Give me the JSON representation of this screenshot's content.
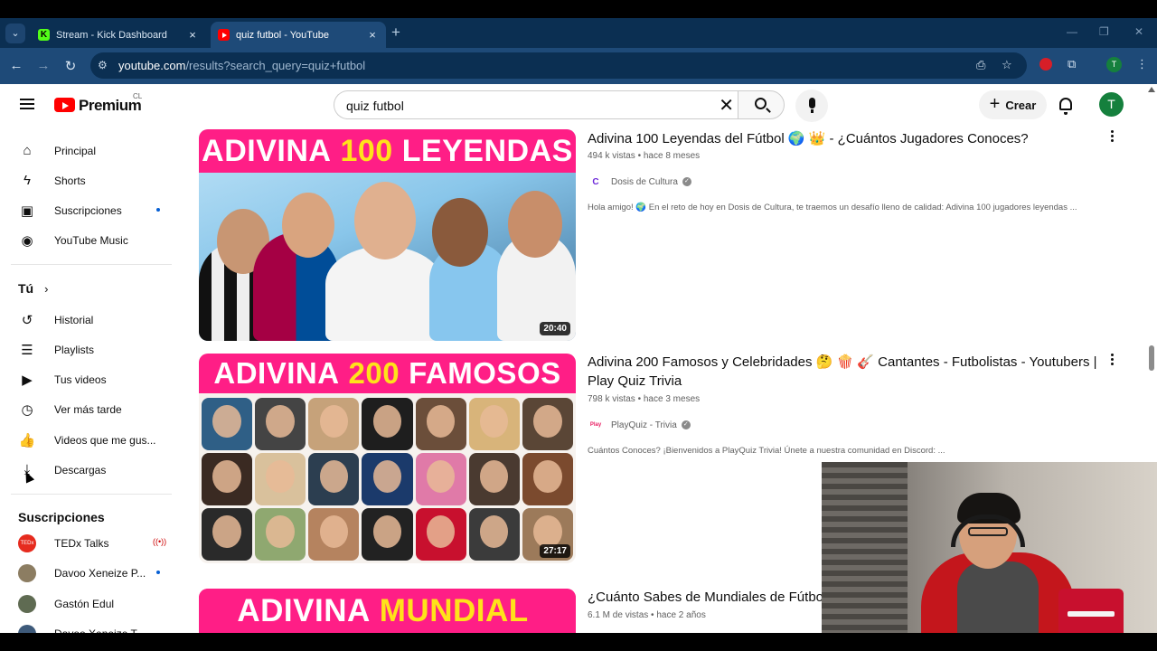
{
  "browser": {
    "tabs": [
      {
        "label": "Stream - Kick Dashboard",
        "active": false
      },
      {
        "label": "quiz futbol - YouTube",
        "active": true
      }
    ],
    "url_host": "youtube.com",
    "url_path": "/results?search_query=quiz+futbol",
    "profile_initial": "T"
  },
  "masthead": {
    "brand": "Premium",
    "country": "CL",
    "search_value": "quiz futbol",
    "create_label": "Crear",
    "avatar_initial": "T"
  },
  "sidebar": {
    "main": [
      {
        "label": "Principal",
        "icon": "home-icon"
      },
      {
        "label": "Shorts",
        "icon": "shorts-icon"
      },
      {
        "label": "Suscripciones",
        "icon": "subscriptions-icon"
      },
      {
        "label": "YouTube Music",
        "icon": "youtube-music-icon"
      }
    ],
    "you_heading": "Tú",
    "you": [
      {
        "label": "Historial",
        "icon": "history-icon"
      },
      {
        "label": "Playlists",
        "icon": "playlists-icon"
      },
      {
        "label": "Tus videos",
        "icon": "your-videos-icon"
      },
      {
        "label": "Ver más tarde",
        "icon": "watch-later-icon"
      },
      {
        "label": "Videos que me gus...",
        "icon": "liked-videos-icon"
      },
      {
        "label": "Descargas",
        "icon": "downloads-icon"
      }
    ],
    "subs_heading": "Suscripciones",
    "subs": [
      {
        "label": "TEDx Talks",
        "avatar": "TEDx"
      },
      {
        "label": "Davoo Xeneize P...",
        "avatar": ""
      },
      {
        "label": "Gastón Edul",
        "avatar": ""
      },
      {
        "label": "Davoo Xeneize T...",
        "avatar": ""
      }
    ]
  },
  "results": [
    {
      "thumb_word": "ADIVINA",
      "thumb_num": "100",
      "thumb_tail": "LEYENDAS",
      "duration": "20:40",
      "title": "Adivina 100 Leyendas del Fútbol 🌍 👑 - ¿Cuántos Jugadores Conoces?",
      "meta_views": "494 k vistas",
      "meta_age": "hace 8 meses",
      "channel": "Dosis de Cultura",
      "channel_initial": "C",
      "description": "Hola amigo! 🌍 En el reto de hoy en Dosis de Cultura, te traemos un desafío lleno de calidad: Adivina 100 jugadores leyendas ..."
    },
    {
      "thumb_word": "ADIVINA",
      "thumb_num": "200",
      "thumb_tail": "FAMOSOS",
      "duration": "27:17",
      "title": "Adivina 200 Famosos y Celebridades 🤔 🍿 🎸 Cantantes - Futbolistas - Youtubers | Play Quiz Trivia",
      "meta_views": "798 k vistas",
      "meta_age": "hace 3 meses",
      "channel": "PlayQuiz - Trivia",
      "channel_initial": "Play",
      "description": "Cuántos Conoces? ¡Bienvenidos a PlayQuiz Trivia! Únete a nuestra comunidad en Discord: ..."
    },
    {
      "thumb_word": "ADIVINA",
      "thumb_num": "MUNDIAL",
      "title": "¿Cuánto Sabes de Mundiales de Fútbol",
      "meta_views": "6.1 M de vistas",
      "meta_age": "hace 2 años"
    }
  ],
  "colors": {
    "yt_red": "#ff0000",
    "banner_pink": "#ff1e86",
    "banner_yellow": "#ffe21a",
    "chrome_dark": "#0b2f52",
    "chrome_mid": "#1e4a78"
  }
}
